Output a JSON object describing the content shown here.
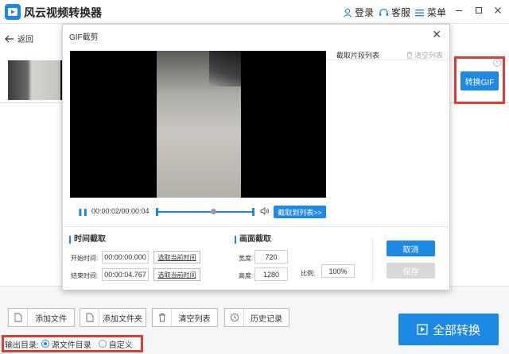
{
  "app": {
    "title": "风云视频转换器"
  },
  "titlebar": {
    "login": "登录",
    "service": "客服",
    "menu": "菜单"
  },
  "nav": {
    "back": "返回"
  },
  "file_item": {
    "convert_gif": "转换GIF"
  },
  "bottom": {
    "add_file": "添加文件",
    "add_folder": "添加文件夹",
    "clear_list": "清空列表",
    "history": "历史记录",
    "convert_all": "全部转换",
    "output_label": "输出目录:",
    "output_source": "源文件目录",
    "output_custom": "自定义",
    "selected_output": "output_source"
  },
  "dialog": {
    "title": "GIF截剪",
    "clip_list_title": "截取片段列表",
    "clip_list_clear": "清空列表",
    "time_display": "00:00:02/00:00:04",
    "clip_to_list": "截取到列表>>",
    "time_section": "时间截取",
    "start_label": "开始时间:",
    "start_value": "00:00:00.000",
    "end_label": "结束时间:",
    "end_value": "00:00:04.767",
    "pick_current": "选取当前时间",
    "frame_section": "画面截取",
    "width_label": "宽度:",
    "width_value": "720",
    "height_label": "高度:",
    "height_value": "1280",
    "ratio_label": "比例:",
    "ratio_value": "100%",
    "cancel": "取消",
    "save": "保存"
  },
  "colors": {
    "accent": "#1e88e5",
    "highlight_border": "#e53935",
    "disabled": "#d8d8d8"
  }
}
